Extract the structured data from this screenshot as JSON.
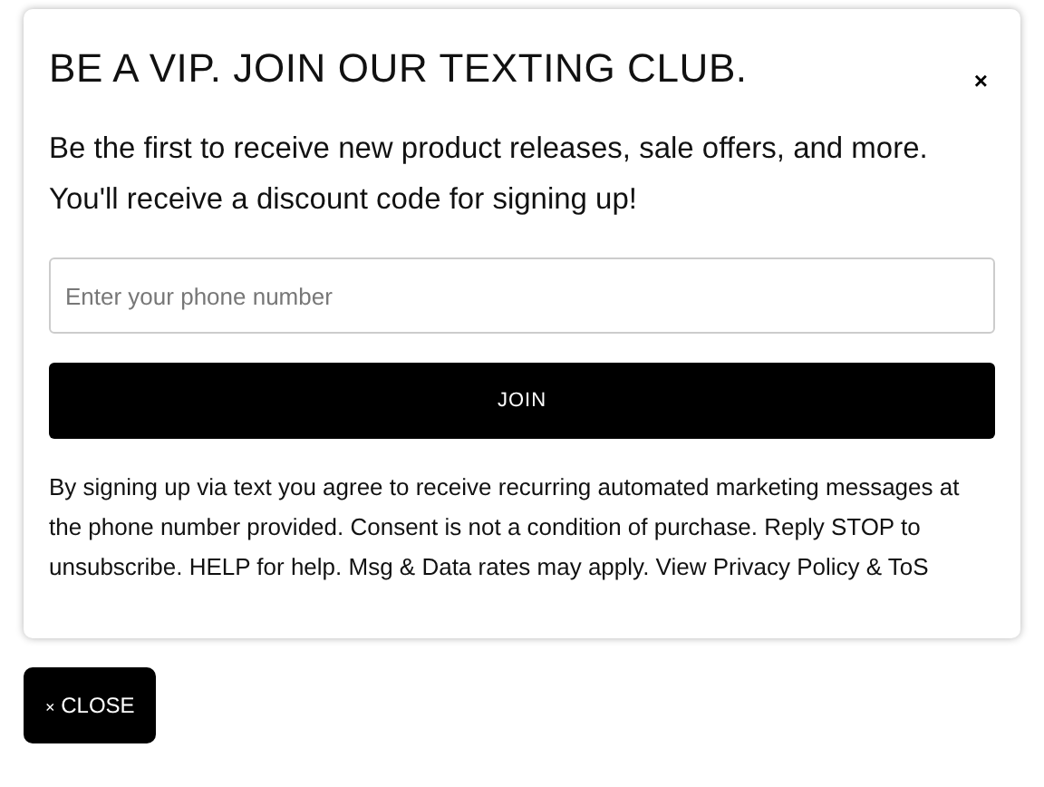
{
  "popup": {
    "title": "BE A VIP. JOIN OUR TEXTING CLUB.",
    "close_icon": "×",
    "description": "Be the first to receive new product releases, sale offers, and more. You'll receive a discount code for signing up!",
    "phone_field": {
      "placeholder": "Enter your phone number"
    },
    "join_button": "JOIN",
    "disclaimer": "By signing up via text you agree to receive recurring automated marketing messages at the phone number provided. Consent is not a condition of purchase. Reply STOP to unsubscribe. HELP for help. Msg & Data rates may apply. View Privacy Policy & ToS"
  },
  "close_tab": {
    "icon": "×",
    "label": "CLOSE"
  }
}
